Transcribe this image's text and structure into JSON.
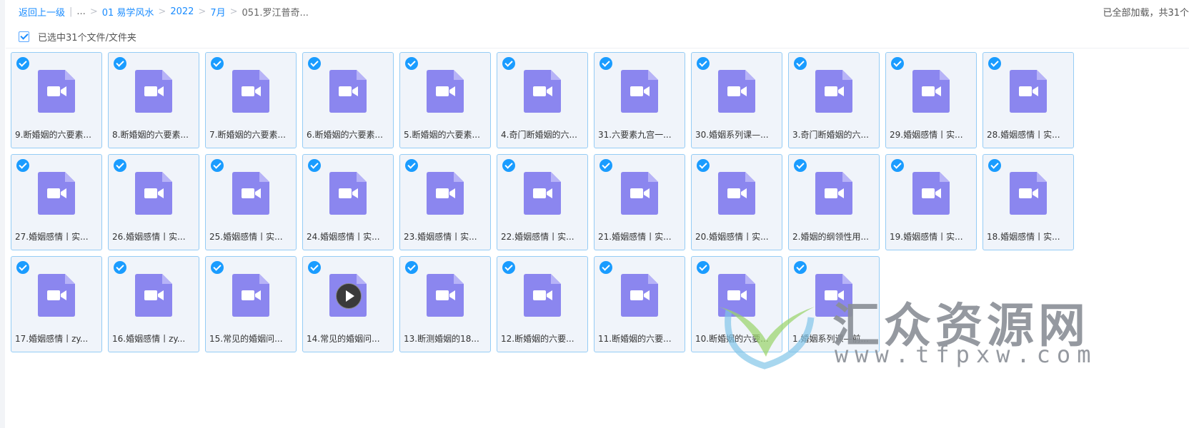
{
  "breadcrumb": {
    "back_label": "返回上一级",
    "ellipsis": "...",
    "items": [
      "01 易学风水",
      "2022",
      "7月"
    ],
    "current": "051.罗江普奇..."
  },
  "status_text": "已全部加载，共31个",
  "selection": {
    "label": "已选中31个文件/文件夹",
    "checked": true
  },
  "icon_names": {
    "file": "video-file-icon",
    "check": "check-circle-icon",
    "play": "play-icon"
  },
  "colors": {
    "file_icon": "#8b86ef",
    "accent": "#1a9cff",
    "tile_border": "#95ccf5",
    "tile_bg": "#f0f4fa"
  },
  "files": [
    {
      "name": "9.断婚姻的六要素..."
    },
    {
      "name": "8.断婚姻的六要素..."
    },
    {
      "name": "7.断婚姻的六要素..."
    },
    {
      "name": "6.断婚姻的六要素..."
    },
    {
      "name": "5.断婚姻的六要素..."
    },
    {
      "name": "4.奇门断婚姻的六..."
    },
    {
      "name": "31.六要素九宫一..."
    },
    {
      "name": "30.婚姻系列课—..."
    },
    {
      "name": "3.奇门断婚姻的六..."
    },
    {
      "name": "29.婚姻感情丨实..."
    },
    {
      "name": "28.婚姻感情丨实..."
    },
    {
      "name": "27.婚姻感情丨实..."
    },
    {
      "name": "26.婚姻感情丨实..."
    },
    {
      "name": "25.婚姻感情丨实..."
    },
    {
      "name": "24.婚姻感情丨实..."
    },
    {
      "name": "23.婚姻感情丨实..."
    },
    {
      "name": "22.婚姻感情丨实..."
    },
    {
      "name": "21.婚姻感情丨实..."
    },
    {
      "name": "20.婚姻感情丨实..."
    },
    {
      "name": "2.婚姻的纲领性用..."
    },
    {
      "name": "19.婚姻感情丨实..."
    },
    {
      "name": "18.婚姻感情丨实..."
    },
    {
      "name": "17.婚姻感情丨zy..."
    },
    {
      "name": "16.婚姻感情丨zy..."
    },
    {
      "name": "15.常见的婚姻问..."
    },
    {
      "name": "14.常见的婚姻问...",
      "playing": true
    },
    {
      "name": "13.断测婚姻的18..."
    },
    {
      "name": "12.断婚姻的六要..."
    },
    {
      "name": "11.断婚姻的六要..."
    },
    {
      "name": "10.断婚姻的六要..."
    },
    {
      "name": "1.婚姻系列课—前..."
    }
  ],
  "watermark": {
    "title": "汇众资源网",
    "url": "www.tfpxw.com"
  }
}
